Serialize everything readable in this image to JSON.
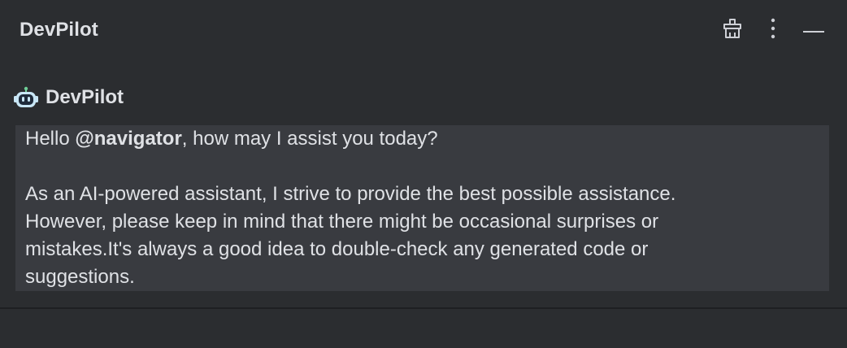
{
  "tool_window": {
    "title": "DevPilot",
    "actions": [
      {
        "icon": "broom-icon",
        "label": ""
      },
      {
        "icon": "more-vertical-icon",
        "label": ""
      },
      {
        "icon": "minimize-icon",
        "label": ""
      }
    ]
  },
  "message": {
    "sender": "DevPilot",
    "avatar_icon": "robot-icon",
    "greeting_prefix": "Hello ",
    "mention": "@navigator",
    "greeting_suffix": ", how may I assist you today?",
    "lines": [
      "As an AI-powered assistant, I strive to provide the best possible assistance.",
      "However, please keep in mind that there might be occasional surprises or",
      "mistakes.It's always a good idea to double-check any generated code or",
      "suggestions."
    ]
  },
  "colors": {
    "background": "#2b2d30",
    "bubble": "#393b40",
    "text": "#dfe1e5",
    "divider": "#1e1f22",
    "robot_body": "#c8e6f5",
    "robot_antenna": "#6fcf97",
    "robot_face": "#1e2a3a"
  }
}
